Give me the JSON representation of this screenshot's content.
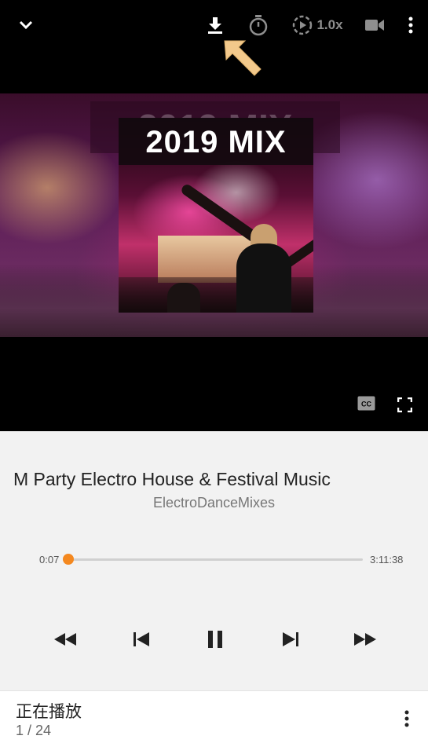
{
  "topbar": {
    "collapse_icon": "chevron-down-icon",
    "download_icon": "download-icon",
    "timer_icon": "stopwatch-icon",
    "speed_icon": "playback-speed-icon",
    "speed_label": "1.0x",
    "video_icon": "video-camera-icon",
    "more_icon": "more-vertical-icon"
  },
  "video": {
    "background_title": "2019 MIX",
    "artwork_title": "2019 MIX",
    "cc_icon": "closed-captions-icon",
    "fullscreen_icon": "fullscreen-icon"
  },
  "annotation": {
    "pointer_icon": "arrow-pointer-icon",
    "color": "#f3c98b"
  },
  "track": {
    "title": "M Party Electro House & Festival Music",
    "channel": "ElectroDanceMixes"
  },
  "progress": {
    "elapsed": "0:07",
    "duration": "3:11:38",
    "fraction": 0.0006,
    "accent": "#f4881f"
  },
  "controls": {
    "rewind_icon": "rewind-icon",
    "previous_icon": "skip-previous-icon",
    "pause_icon": "pause-icon",
    "next_icon": "skip-next-icon",
    "forward_icon": "fast-forward-icon"
  },
  "footer": {
    "now_playing": "正在播放",
    "position": "1 / 24",
    "more_icon": "more-vertical-icon"
  }
}
